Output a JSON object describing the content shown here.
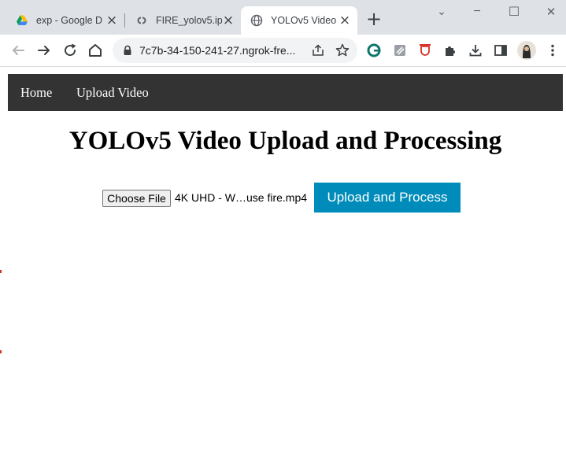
{
  "browser": {
    "tabs": [
      {
        "label": "exp - Google D",
        "favicon": "google-drive-icon",
        "active": false
      },
      {
        "label": "FIRE_yolov5.ipy",
        "favicon": "colab-icon",
        "active": false
      },
      {
        "label": "YOLOv5 Video",
        "favicon": "globe-icon",
        "active": true
      }
    ],
    "close_glyph": "×",
    "new_tab_glyph": "+",
    "window_controls": {
      "minimize": "─",
      "maximize": "☐",
      "close": "✕",
      "tab_search": "⌄"
    },
    "url": "7c7b-34-150-241-27.ngrok-fre...",
    "extensions": [
      "grammarly-icon",
      "notes-extension-icon",
      "shield-extension-icon",
      "puzzle-extensions-icon",
      "download-icon",
      "side-panel-icon",
      "profile-avatar",
      "more-menu-icon"
    ],
    "colors": {
      "tabstrip": "#dee1e6",
      "omnibox": "#f1f3f4"
    }
  },
  "page": {
    "nav": {
      "home": "Home",
      "upload": "Upload Video"
    },
    "title": "YOLOv5 Video Upload and Processing",
    "file_input": {
      "button_label": "Choose File",
      "selected_file": "4K UHD - W…use fire.mp4"
    },
    "submit_label": "Upload and Process",
    "colors": {
      "navbar": "#333333",
      "submit": "#008cba"
    }
  }
}
